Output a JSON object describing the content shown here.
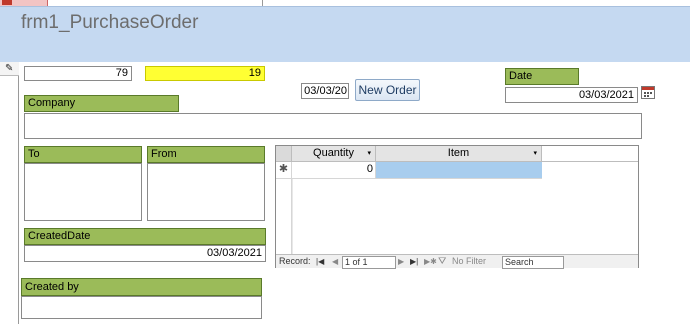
{
  "form": {
    "title": "frm1_PurchaseOrder",
    "field_id": "79",
    "field_highlight": "19",
    "order_date_short": "03/03/20",
    "new_order_button": "New Order",
    "date_label": "Date",
    "date_value": "03/03/2021",
    "company_label": "Company",
    "company_value": "",
    "to_label": "To",
    "from_label": "From",
    "created_date_label": "CreatedDate",
    "created_date_value": "03/03/2021",
    "created_by_label": "Created by",
    "created_by_value": ""
  },
  "subform": {
    "columns": [
      "Quantity",
      "Item"
    ],
    "new_row_marker": "✱",
    "new_row_quantity": "0",
    "nav": {
      "record_label": "Record:",
      "position": "1 of 1",
      "filter_label": "No Filter",
      "search_placeholder": "Search"
    }
  },
  "icons": {
    "record_selector": "pencil-icon",
    "date_picker": "calendar-icon",
    "filter": "filter-icon"
  },
  "colors": {
    "header_bg": "#c5d9f1",
    "label_bg": "#9bbb59",
    "highlight": "#ffff33",
    "selected_cell": "#a8cdee"
  }
}
